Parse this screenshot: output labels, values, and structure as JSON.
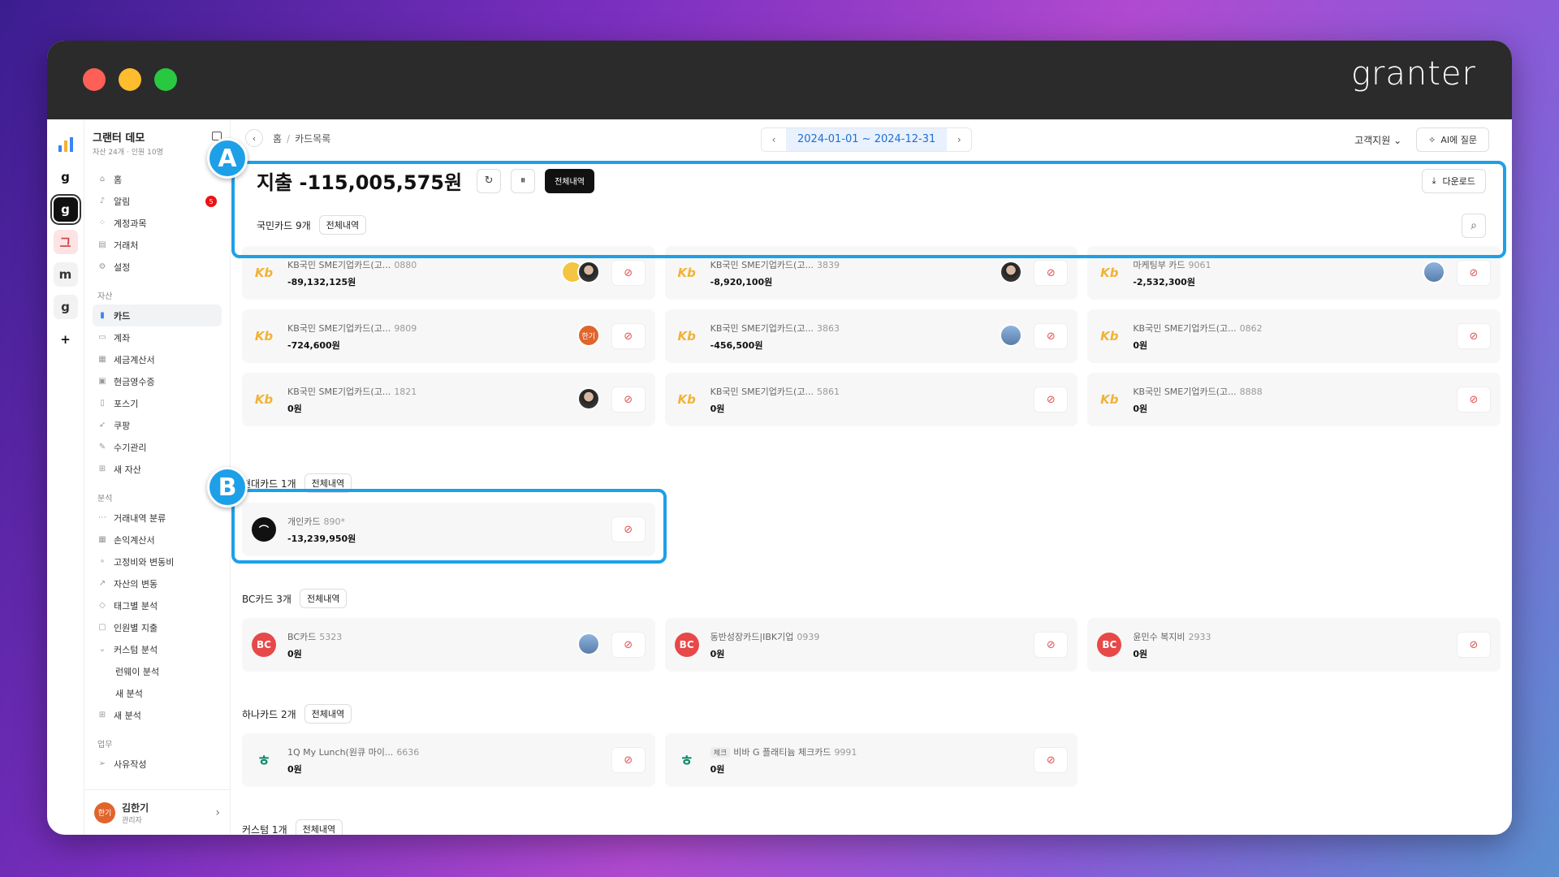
{
  "window": {
    "brand": "granter"
  },
  "rail": {
    "items": [
      "g",
      "g",
      "그",
      "m",
      "g",
      "+"
    ]
  },
  "sidebar": {
    "org_name": "그랜터 데모",
    "org_sub": "자산 24개 · 인원 10명",
    "top_items": [
      {
        "label": "홈",
        "icon": "home-icon"
      },
      {
        "label": "알림",
        "icon": "bell-icon",
        "badge": "5"
      },
      {
        "label": "계정과목",
        "icon": "account-icon"
      },
      {
        "label": "거래처",
        "icon": "vendor-icon"
      },
      {
        "label": "설정",
        "icon": "gear-icon"
      }
    ],
    "asset_section": "자산",
    "asset_items": [
      {
        "label": "카드"
      },
      {
        "label": "계좌"
      },
      {
        "label": "세금계산서"
      },
      {
        "label": "현금영수증"
      },
      {
        "label": "포스기"
      },
      {
        "label": "쿠팡"
      },
      {
        "label": "수기관리"
      },
      {
        "label": "새 자산"
      }
    ],
    "analysis_section": "분석",
    "analysis_items": [
      {
        "label": "거래내역 분류"
      },
      {
        "label": "손익계산서"
      },
      {
        "label": "고정비와 변동비"
      },
      {
        "label": "자산의 변동"
      },
      {
        "label": "태그별 분석"
      },
      {
        "label": "인원별 지출"
      },
      {
        "label": "커스텀 분석"
      },
      {
        "label": "런웨이 분석"
      },
      {
        "label": "새 분석"
      },
      {
        "label": "새 분석"
      }
    ],
    "work_section": "업무",
    "work_items": [
      {
        "label": "사유작성"
      }
    ],
    "user": {
      "avatar": "한기",
      "name": "김한기",
      "role": "관리자"
    }
  },
  "topbar": {
    "breadcrumb": [
      "홈",
      "카드목록"
    ],
    "date_range": "2024-01-01 ~ 2024-12-31",
    "support": "고객지원",
    "ai_button": "AI에 질문"
  },
  "header": {
    "total": "지출 -115,005,575원",
    "all_history": "전체내역",
    "download": "다운로드"
  },
  "groups": {
    "kb": {
      "label": "국민카드 9개",
      "btn": "전체내역"
    },
    "hyundai": {
      "label": "현대카드 1개",
      "btn": "전체내역"
    },
    "bc": {
      "label": "BC카드 3개",
      "btn": "전체내역"
    },
    "hana": {
      "label": "하나카드 2개",
      "btn": "전체내역"
    },
    "custom": {
      "label": "커스텀 1개",
      "btn": "전체내역"
    }
  },
  "cards": {
    "kb": [
      {
        "name": "KB국민 SME기업카드(고...",
        "num": "0880",
        "value": "-89,132,125원"
      },
      {
        "name": "KB국민 SME기업카드(고...",
        "num": "3839",
        "value": "-8,920,100원"
      },
      {
        "name": "마케팅부 카드",
        "num": "9061",
        "value": "-2,532,300원"
      },
      {
        "name": "KB국민 SME기업카드(고...",
        "num": "9809",
        "value": "-724,600원",
        "avatar": "한기"
      },
      {
        "name": "KB국민 SME기업카드(고...",
        "num": "3863",
        "value": "-456,500원"
      },
      {
        "name": "KB국민 SME기업카드(고...",
        "num": "0862",
        "value": "0원"
      },
      {
        "name": "KB국민 SME기업카드(고...",
        "num": "1821",
        "value": "0원"
      },
      {
        "name": "KB국민 SME기업카드(고...",
        "num": "5861",
        "value": "0원"
      },
      {
        "name": "KB국민 SME기업카드(고...",
        "num": "8888",
        "value": "0원"
      }
    ],
    "hyundai": [
      {
        "name": "개인카드",
        "num": "890*",
        "value": "-13,239,950원"
      }
    ],
    "bc": [
      {
        "name": "BC카드",
        "num": "5323",
        "value": "0원"
      },
      {
        "name": "동반성장카드|IBK기업",
        "num": "0939",
        "value": "0원"
      },
      {
        "name": "윤민수 복지비",
        "num": "2933",
        "value": "0원"
      }
    ],
    "hana": [
      {
        "name": "1Q My Lunch(원큐 마이...",
        "num": "6636",
        "value": "0원"
      },
      {
        "chip": "체크",
        "name": "비바 G 플래티늄 체크카드",
        "num": "9991",
        "value": "0원"
      }
    ]
  },
  "logos": {
    "kb": "Kb",
    "bc": "BC",
    "hana": "ㅎ",
    "hd": "⌒"
  },
  "markers": {
    "a": "A",
    "b": "B"
  },
  "colors": {
    "accent": "#1da0e8",
    "kb": "#f2b233",
    "bc": "#e74848",
    "hana": "#0a8a6a"
  }
}
